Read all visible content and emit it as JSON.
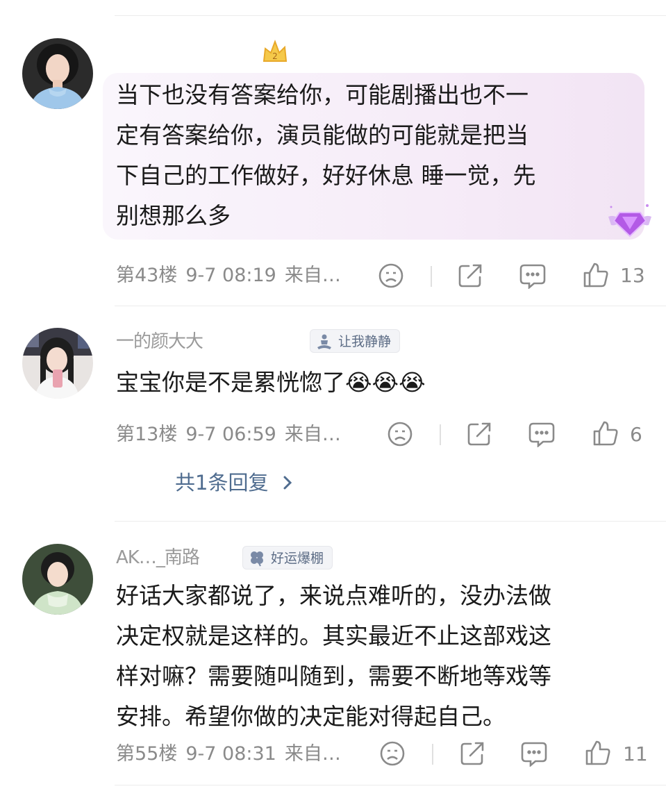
{
  "comments": [
    {
      "name": "",
      "text": "当下也没有答案给你，可能剧播出也不一\n定有答案给你，演员能做的可能就是把当\n下自己的工作做好，好好休息 睡一觉，先\n别想那么多",
      "floor": "第43楼",
      "time": "9-7 08:19",
      "source": "来自…",
      "likes": "13",
      "icons": [
        "avatar-girl-blue-sweater",
        "vip-crown-icon",
        "sad-face-icon",
        "share-icon",
        "comment-icon",
        "thumb-up-icon",
        "diamond-wings-icon"
      ]
    },
    {
      "name": "一的颜大大",
      "badge": "让我静静",
      "text": "宝宝你是不是累恍惚了😭😭😭",
      "floor": "第13楼",
      "time": "9-7 06:59",
      "source": "来自…",
      "likes": "6",
      "replies": "共1条回复",
      "icons": [
        "meditation-icon",
        "sad-face-icon",
        "share-icon",
        "comment-icon",
        "thumb-up-icon",
        "chevron-right-icon"
      ]
    },
    {
      "name": "AK…_南路",
      "badge": "好运爆棚",
      "text": "好话大家都说了，来说点难听的，没办法做\n决定权就是这样的。其实最近不止这部戏这\n样对嘛？需要随叫随到，需要不断地等戏等\n安排。希望你做的决定能对得起自己。",
      "floor": "第55楼",
      "time": "9-7 08:31",
      "source": "来自…",
      "likes": "11",
      "icons": [
        "clover-icon",
        "sad-face-icon",
        "share-icon",
        "comment-icon",
        "thumb-up-icon"
      ]
    }
  ],
  "colors": {
    "meta": "#8a8a8a",
    "link": "#4f6c8f",
    "text": "#1a1a1a",
    "bubble": "#f6ecf8"
  }
}
